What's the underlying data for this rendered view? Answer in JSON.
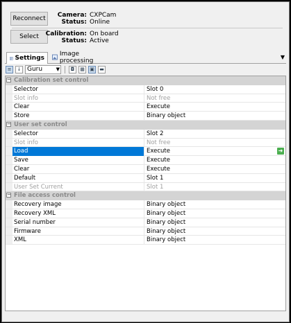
{
  "camera_panel": {
    "reconnect_label": "Reconnect",
    "select_label": "Select",
    "camera_key": "Camera:",
    "camera_value": "CXPCam",
    "status_key": "Status:",
    "status_value": "Online",
    "calibration_key": "Calibration:",
    "calibration_value": "On board",
    "status2_key": "Status:",
    "status2_value": "Active"
  },
  "tabs": [
    {
      "label": "Settings",
      "icon": "settings-icon"
    },
    {
      "label": "Image processing",
      "icon": "image-processing-icon"
    }
  ],
  "toolbar": {
    "visibility_level": "Guru"
  },
  "grid": {
    "categories": [
      {
        "label": "Calibration set control",
        "rows": [
          {
            "name": "Selector",
            "value": "Slot 0",
            "disabled": false
          },
          {
            "name": "Slot info",
            "value": "Not free",
            "disabled": true
          },
          {
            "name": "Clear",
            "value": "Execute",
            "disabled": false
          },
          {
            "name": "Store",
            "value": "Binary object",
            "disabled": false
          }
        ]
      },
      {
        "label": "User set control",
        "rows": [
          {
            "name": "Selector",
            "value": "Slot 2",
            "disabled": false
          },
          {
            "name": "Slot info",
            "value": "Not free",
            "disabled": true
          },
          {
            "name": "Load",
            "value": "Execute",
            "disabled": false,
            "selected": true
          },
          {
            "name": "Save",
            "value": "Execute",
            "disabled": false
          },
          {
            "name": "Clear",
            "value": "Execute",
            "disabled": false
          },
          {
            "name": "Default",
            "value": "Slot 1",
            "disabled": false
          },
          {
            "name": "User Set Current",
            "value": "Slot 1",
            "disabled": true
          }
        ]
      },
      {
        "label": "File access control",
        "rows": [
          {
            "name": "Recovery image",
            "value": "Binary object",
            "disabled": false
          },
          {
            "name": "Recovery XML",
            "value": "Binary object",
            "disabled": false
          },
          {
            "name": "Serial number",
            "value": "Binary object",
            "disabled": false
          },
          {
            "name": "Firmware",
            "value": "Binary object",
            "disabled": false
          },
          {
            "name": "XML",
            "value": "Binary object",
            "disabled": false
          }
        ]
      }
    ]
  },
  "colors": {
    "selection": "#0078d7",
    "category_bg": "#d4d4d4",
    "execute_icon": "#4caf50"
  }
}
